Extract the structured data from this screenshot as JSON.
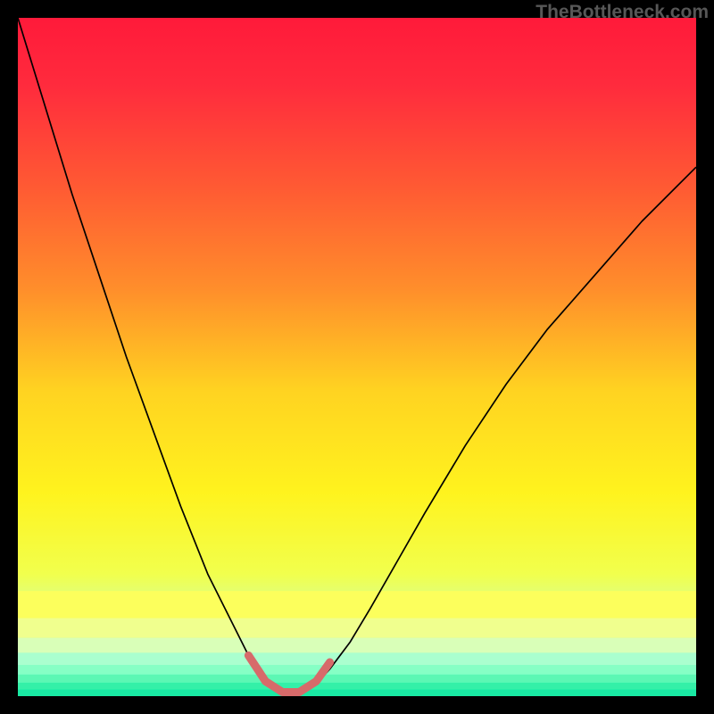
{
  "watermark": "TheBottleneck.com",
  "chart_data": {
    "type": "line",
    "title": "",
    "xlabel": "",
    "ylabel": "",
    "xlim": [
      0,
      100
    ],
    "ylim": [
      0,
      100
    ],
    "grid": false,
    "legend": false,
    "gradient_stops": [
      {
        "offset": 0.0,
        "color": "#ff1a3a"
      },
      {
        "offset": 0.1,
        "color": "#ff2b3d"
      },
      {
        "offset": 0.25,
        "color": "#ff5a33"
      },
      {
        "offset": 0.4,
        "color": "#ff8e2b"
      },
      {
        "offset": 0.55,
        "color": "#ffd321"
      },
      {
        "offset": 0.7,
        "color": "#fff31e"
      },
      {
        "offset": 0.82,
        "color": "#f1ff4d"
      },
      {
        "offset": 0.9,
        "color": "#ccffb0"
      },
      {
        "offset": 0.96,
        "color": "#7bffc9"
      },
      {
        "offset": 1.0,
        "color": "#22ffb8"
      }
    ],
    "series": [
      {
        "name": "curve",
        "color": "#000000",
        "stroke_width": 1.7,
        "x": [
          0,
          4,
          8,
          12,
          16,
          20,
          24,
          28,
          32,
          34,
          36,
          37.5,
          39,
          40.5,
          42,
          44,
          46,
          49,
          52,
          56,
          60,
          66,
          72,
          78,
          85,
          92,
          100
        ],
        "y": [
          100,
          87,
          74,
          62,
          50,
          39,
          28,
          18,
          10,
          6,
          3,
          1.5,
          0.7,
          0.4,
          0.7,
          1.8,
          4,
          8,
          13,
          20,
          27,
          37,
          46,
          54,
          62,
          70,
          78
        ]
      },
      {
        "name": "highlight",
        "color": "#d76a6a",
        "stroke_width": 9,
        "x": [
          34,
          36.5,
          39,
          41.5,
          44,
          46
        ],
        "y": [
          6,
          2.2,
          0.6,
          0.6,
          2.2,
          5
        ]
      }
    ],
    "bottom_bands": [
      {
        "y0": 0.0,
        "y1": 1.0,
        "color": "#19e9a3"
      },
      {
        "y0": 1.0,
        "y1": 2.0,
        "color": "#34f0a8"
      },
      {
        "y0": 2.0,
        "y1": 3.2,
        "color": "#5cf7b4"
      },
      {
        "y0": 3.2,
        "y1": 4.6,
        "color": "#86ffc5"
      },
      {
        "y0": 4.6,
        "y1": 6.4,
        "color": "#aaffcf"
      },
      {
        "y0": 6.4,
        "y1": 8.6,
        "color": "#d9ffb8"
      },
      {
        "y0": 8.6,
        "y1": 11.5,
        "color": "#f0ff8e"
      },
      {
        "y0": 11.5,
        "y1": 15.5,
        "color": "#fcff5c"
      }
    ]
  }
}
